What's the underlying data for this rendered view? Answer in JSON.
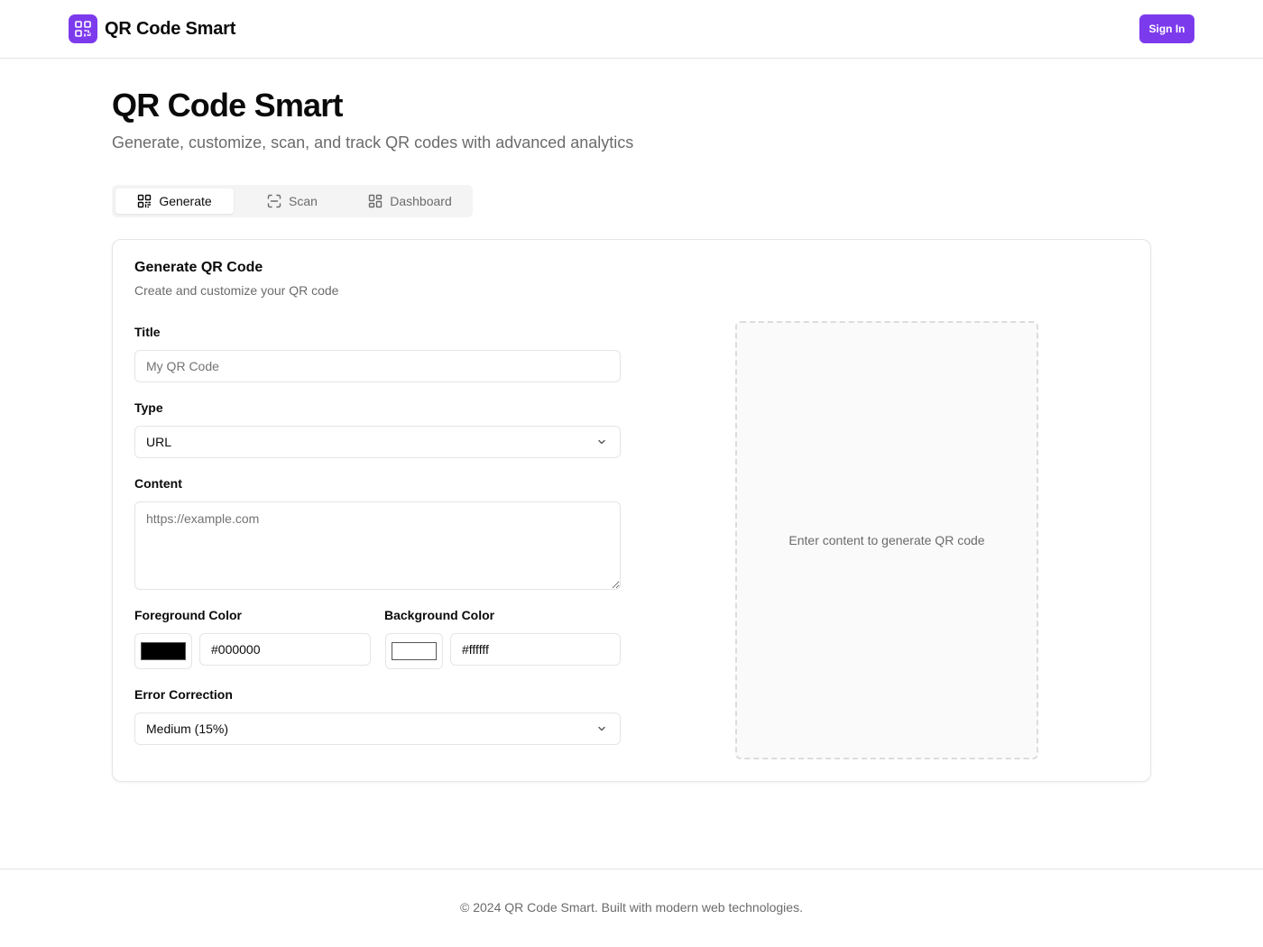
{
  "header": {
    "brand_name": "QR Code Smart",
    "sign_in_label": "Sign In",
    "accent_color": "#7c3aed"
  },
  "hero": {
    "title": "QR Code Smart",
    "subtitle": "Generate, customize, scan, and track QR codes with advanced analytics"
  },
  "tabs": [
    {
      "label": "Generate",
      "icon": "qr-code-icon",
      "active": true
    },
    {
      "label": "Scan",
      "icon": "scan-icon",
      "active": false
    },
    {
      "label": "Dashboard",
      "icon": "dashboard-icon",
      "active": false
    }
  ],
  "card": {
    "title": "Generate QR Code",
    "description": "Create and customize your QR code",
    "form": {
      "title_label": "Title",
      "title_placeholder": "My QR Code",
      "title_value": "",
      "type_label": "Type",
      "type_value": "URL",
      "content_label": "Content",
      "content_placeholder": "https://example.com",
      "content_value": "",
      "foreground_label": "Foreground Color",
      "foreground_value": "#000000",
      "background_label": "Background Color",
      "background_value": "#ffffff",
      "error_correction_label": "Error Correction",
      "error_correction_value": "Medium (15%)"
    },
    "preview_text": "Enter content to generate QR code"
  },
  "footer": {
    "text": "© 2024 QR Code Smart. Built with modern web technologies."
  }
}
